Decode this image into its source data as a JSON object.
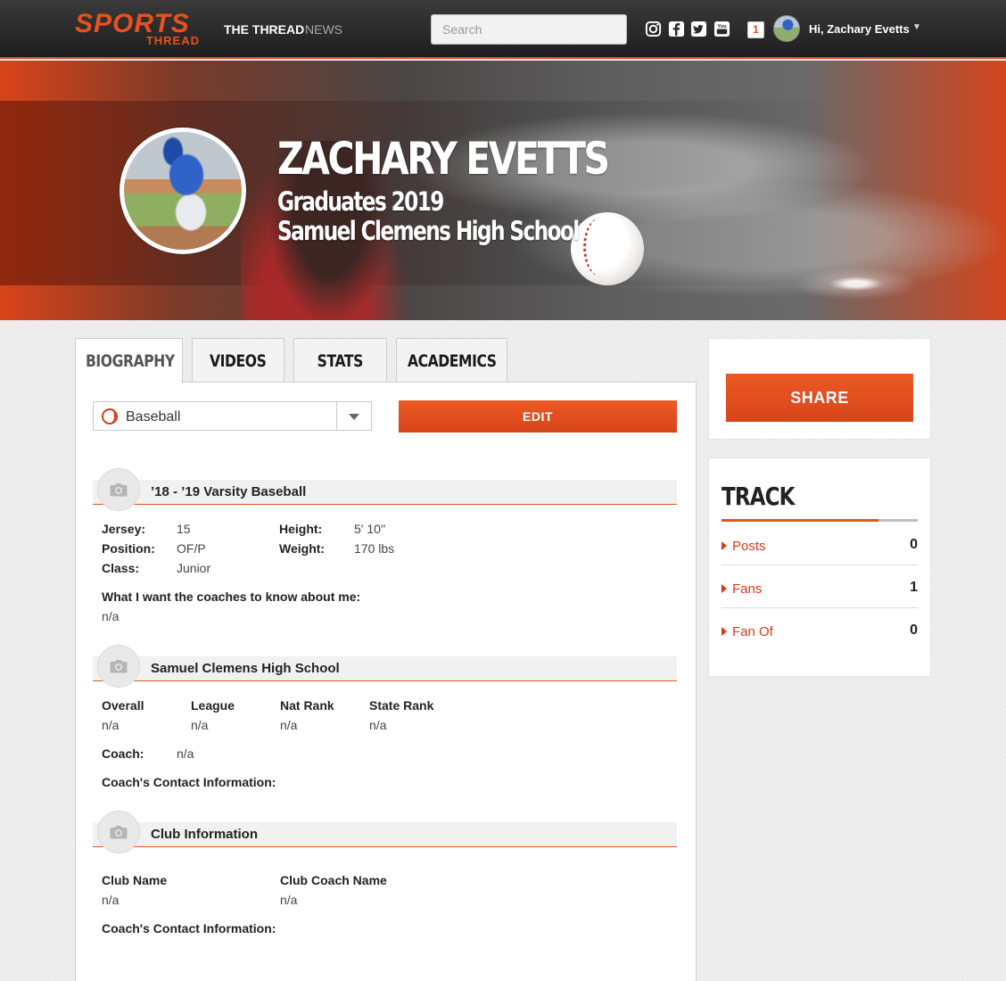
{
  "nav": {
    "logo_top": "SPORTS",
    "logo_bottom": "THREAD",
    "links": [
      "THE THREAD",
      "NEWS"
    ],
    "search_placeholder": "Search",
    "social_icons": [
      "instagram-icon",
      "facebook-icon",
      "twitter-icon",
      "youtube-icon"
    ],
    "notification_count": "1",
    "greeting": "Hi, Zachary Evetts"
  },
  "hero": {
    "name": "ZACHARY EVETTS",
    "graduates": "Graduates 2019",
    "school": "Samuel Clemens High School"
  },
  "tabs": [
    "BIOGRAPHY",
    "VIDEOS",
    "STATS",
    "ACADEMICS"
  ],
  "sport_select": {
    "value": "Baseball"
  },
  "edit_label": "EDIT",
  "sections": {
    "varsity": {
      "title": "’18 - ’19 Varsity Baseball",
      "jersey_label": "Jersey:",
      "jersey": "15",
      "position_label": "Position:",
      "position": "OF/P",
      "class_label": "Class:",
      "class": "Junior",
      "height_label": "Height:",
      "height": "5' 10''",
      "weight_label": "Weight:",
      "weight": "170 lbs",
      "coaches_label": "What I want the coaches to know about me:",
      "coaches_value": "n/a"
    },
    "school": {
      "title": "Samuel Clemens High School",
      "overall_label": "Overall",
      "overall": "n/a",
      "league_label": "League",
      "league": "n/a",
      "nat_rank_label": "Nat Rank",
      "nat_rank": "n/a",
      "state_rank_label": "State Rank",
      "state_rank": "n/a",
      "coach_label": "Coach:",
      "coach": "n/a",
      "contact_label": "Coach's Contact Information:"
    },
    "club": {
      "title": "Club Information",
      "club_name_label": "Club Name",
      "club_name": "n/a",
      "club_coach_label": "Club Coach Name",
      "club_coach": "n/a",
      "contact_label": "Coach's Contact Information:"
    }
  },
  "share_label": "SHARE",
  "track": {
    "title": "TRACK",
    "rows": [
      {
        "label": "Posts",
        "count": "0"
      },
      {
        "label": "Fans",
        "count": "1"
      },
      {
        "label": "Fan Of",
        "count": "0"
      }
    ]
  },
  "colors": {
    "accent": "#e24b1c",
    "nav_bg": "#2a2a2a",
    "link": "#d9391c"
  }
}
